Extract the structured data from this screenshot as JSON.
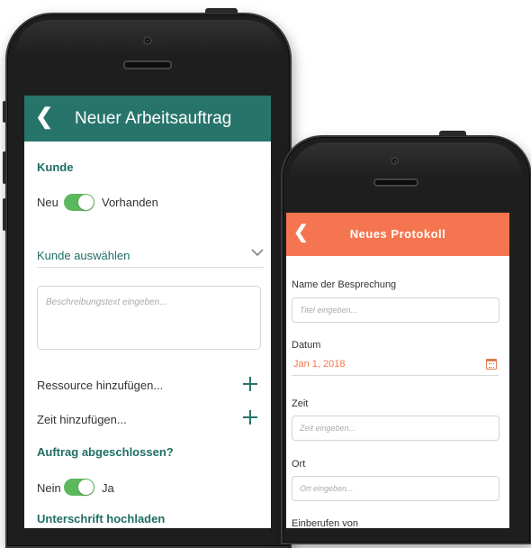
{
  "screen1": {
    "appbar": {
      "back_icon": "chevron-left-icon",
      "title": "Neuer Arbeitsauftrag",
      "color": "#27746a"
    },
    "kunde": {
      "heading": "Kunde",
      "toggle_left_label": "Neu",
      "toggle_right_label": "Vorhanden",
      "select_label": "Kunde auswählen",
      "select_icon": "chevron-down-icon"
    },
    "description_placeholder": "Beschreibungstext eingeben...",
    "add_resource_label": "Ressource hinzufügen...",
    "add_time_label": "Zeit hinzufügen...",
    "completed": {
      "heading": "Auftrag abgeschlossen?",
      "toggle_left_label": "Nein",
      "toggle_right_label": "Ja"
    },
    "signature_heading": "Unterschrift hochladen",
    "toggle_color": "#5cb85c"
  },
  "screen2": {
    "appbar": {
      "back_icon": "chevron-left-icon",
      "title": "Neues Protokoll",
      "color": "#f47550"
    },
    "meeting_name": {
      "label": "Name der Besprechung",
      "placeholder": "Titel eingeben..."
    },
    "date": {
      "label": "Datum",
      "value": "Jan 1, 2018",
      "icon": "calendar-icon"
    },
    "time": {
      "label": "Zeit",
      "placeholder": "Zeit eingeben..."
    },
    "place": {
      "label": "Ort",
      "placeholder": "Ort eingeben..."
    },
    "convened_by_label": "Einberufen von"
  }
}
